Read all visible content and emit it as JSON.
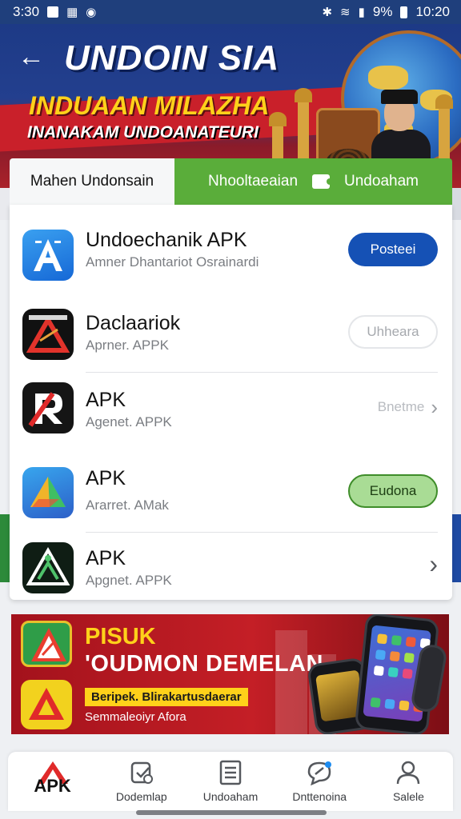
{
  "status_bar": {
    "time": "3:30",
    "battery": "9%",
    "clock": "10:20"
  },
  "hero": {
    "title": "UNDOIN SIA",
    "subtitle": "INDUAAN MILAZHA",
    "tagline": "INANAKAM UNDOANATEURI"
  },
  "tabs": [
    {
      "label": "Mahen Undonsain",
      "active": false
    },
    {
      "label": "Nhooltaeaian",
      "secondary_label": "Undoaham",
      "active": true
    }
  ],
  "apps": [
    {
      "name": "Undoechanik APK",
      "subtitle": "Amner Dhantariot Osrainardi",
      "action": "Posteei",
      "action_style": "primary",
      "icon": "letter-a-blue-icon"
    },
    {
      "name": "Daclaariok",
      "subtitle": "Aprner. APPK",
      "action": "Uhheara",
      "action_style": "outline",
      "icon": "red-triangle-dark-icon"
    },
    {
      "name": "APK",
      "subtitle": "Agenet. APPK",
      "action": "Bnetme",
      "action_style": "text-chevron",
      "icon": "red-r-letter-icon"
    },
    {
      "name": "APK",
      "subtitle": "Ararret. AMak",
      "action": "Eudona",
      "action_style": "green",
      "icon": "blue-triangle-icon"
    },
    {
      "name": "APK",
      "subtitle": "Apgnet. APPK",
      "action": "",
      "action_style": "chevron",
      "icon": "green-triangle-dark-icon"
    }
  ],
  "promo": {
    "title": "PISUK",
    "headline": "'OUDMON DEMELAN",
    "tag": "Beripek. Blirakartusdaerar",
    "footer": "Semmaleoiyr Afora"
  },
  "bottom_nav": [
    {
      "label": "APK",
      "icon": "apk-logo-icon",
      "active": true
    },
    {
      "label": "Dodemlap",
      "icon": "clipboard-icon"
    },
    {
      "label": "Undoaham",
      "icon": "list-document-icon"
    },
    {
      "label": "Dnttenoina",
      "icon": "chat-bubble-icon"
    },
    {
      "label": "Salele",
      "icon": "person-icon"
    }
  ],
  "colors": {
    "accent_blue": "#1551b5",
    "accent_green": "#5aad3a",
    "banner_red": "#c41f26",
    "banner_blue": "#1d3a86",
    "promo_yellow": "#ffd11a"
  }
}
